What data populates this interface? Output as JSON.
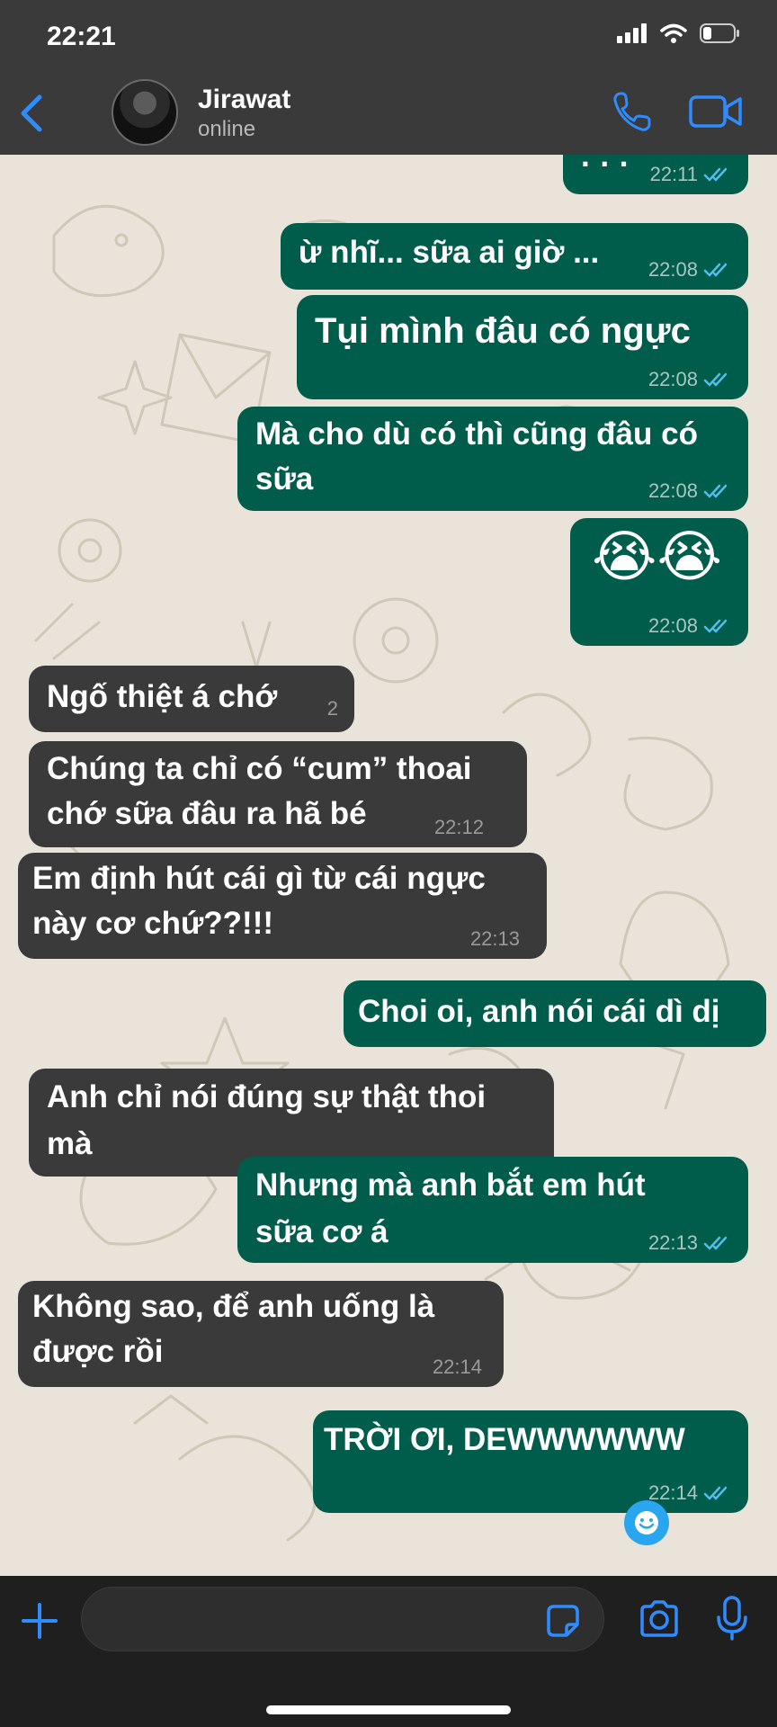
{
  "status_bar": {
    "time": "22:21"
  },
  "header": {
    "contact_name": "Jirawat",
    "contact_status": "online"
  },
  "messages": [
    {
      "dir": "out",
      "text": "· · ·",
      "time": "22:11"
    },
    {
      "dir": "out",
      "text": "ừ nhĩ... sữa ai giờ ...",
      "time": "22:08"
    },
    {
      "dir": "out",
      "text": "Tụi mình đâu có ngực",
      "time": "22:08"
    },
    {
      "dir": "out",
      "text": "Mà cho dù có thì cũng đâu có sữa",
      "time": "22:08"
    },
    {
      "dir": "out",
      "text": "😭😭",
      "time": "22:08"
    },
    {
      "dir": "in",
      "text": "Ngố thiệt á chớ",
      "time": "2"
    },
    {
      "dir": "in",
      "text": "Chúng ta chỉ có “cum” thoai chớ sữa đâu ra hã bé",
      "time": "22:12"
    },
    {
      "dir": "in",
      "text": "Em định hút cái gì từ cái ngực này cơ chứ??!!!",
      "time": "22:13"
    },
    {
      "dir": "out",
      "text": "Choi oi, anh nói cái dì dị",
      "time": ""
    },
    {
      "dir": "in",
      "text": "Anh chỉ nói đúng sự thật thoi mà",
      "time": ""
    },
    {
      "dir": "out",
      "text": "Nhưng mà anh bắt em hút sữa cơ á",
      "time": "22:13"
    },
    {
      "dir": "in",
      "text": "Không sao, để anh uống là được rồi",
      "time": "22:14"
    },
    {
      "dir": "out",
      "text": "TRỜI ƠI, DEWWWWWW",
      "time": "22:14"
    }
  ],
  "colors": {
    "outgoing_bubble": "#005c4b",
    "incoming_bubble": "#3a3a3a",
    "accent": "#2f8cff",
    "chat_background": "#e9e3d9"
  },
  "icons": {
    "back": "chevron-left-icon",
    "call": "phone-icon",
    "video": "video-camera-icon",
    "attach": "plus-icon",
    "sticker": "sticker-icon",
    "camera": "camera-icon",
    "mic": "microphone-icon",
    "read": "double-check-icon"
  },
  "composer": {
    "placeholder": ""
  }
}
